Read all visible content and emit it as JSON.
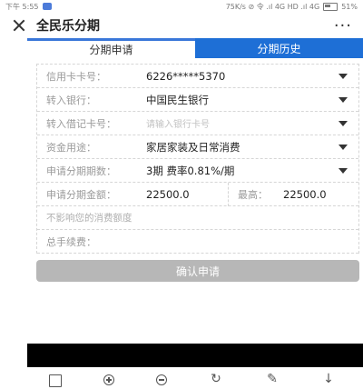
{
  "status": {
    "time": "下午 5:55",
    "network": "75K/s ⊘ 令 .ıl 4G HD .ıl 4G",
    "battery": "51%"
  },
  "header": {
    "title": "全民乐分期",
    "more": "···"
  },
  "tabs": [
    {
      "label": "分期申请"
    },
    {
      "label": "分期历史"
    }
  ],
  "form": {
    "card": {
      "label": "信用卡卡号：",
      "value": "6226*****5370"
    },
    "bank": {
      "label": "转入银行：",
      "value": "中国民生银行"
    },
    "debit": {
      "label": "转入借记卡号：",
      "placeholder": "请输入银行卡号"
    },
    "purpose": {
      "label": "资金用途：",
      "value": "家居家装及日常消费"
    },
    "period": {
      "label": "申请分期期数：",
      "value": "3期 费率0.81%/期"
    },
    "amount": {
      "label": "申请分期金额：",
      "value": "22500.0",
      "max_label": "最高：",
      "max_value": "22500.0"
    },
    "note": "不影响您的消费额度",
    "fee": {
      "label": "总手续费："
    }
  },
  "confirm_button": "确认申请"
}
